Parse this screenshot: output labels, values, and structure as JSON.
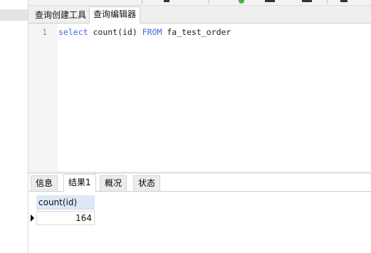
{
  "top_tabs": [
    {
      "label": "查询创建工具",
      "active": false
    },
    {
      "label": "查询编辑器",
      "active": true
    }
  ],
  "editor": {
    "line_number": "1",
    "code": {
      "kw1": "select",
      "mid": " count(id) ",
      "kw2": "FROM",
      "tail": " fa_test_order"
    },
    "keyword_color": "#4169e1"
  },
  "result_tabs": [
    {
      "label": "信息",
      "active": false
    },
    {
      "label": "结果1",
      "active": true
    },
    {
      "label": "概况",
      "active": false
    },
    {
      "label": "状态",
      "active": false
    }
  ],
  "result_grid": {
    "columns": [
      "count(id)"
    ],
    "rows": [
      [
        "164"
      ]
    ],
    "header_color": "#dde9f7"
  },
  "icons": {
    "row_indicator": "row-pointer-icon",
    "run": "run-icon"
  }
}
